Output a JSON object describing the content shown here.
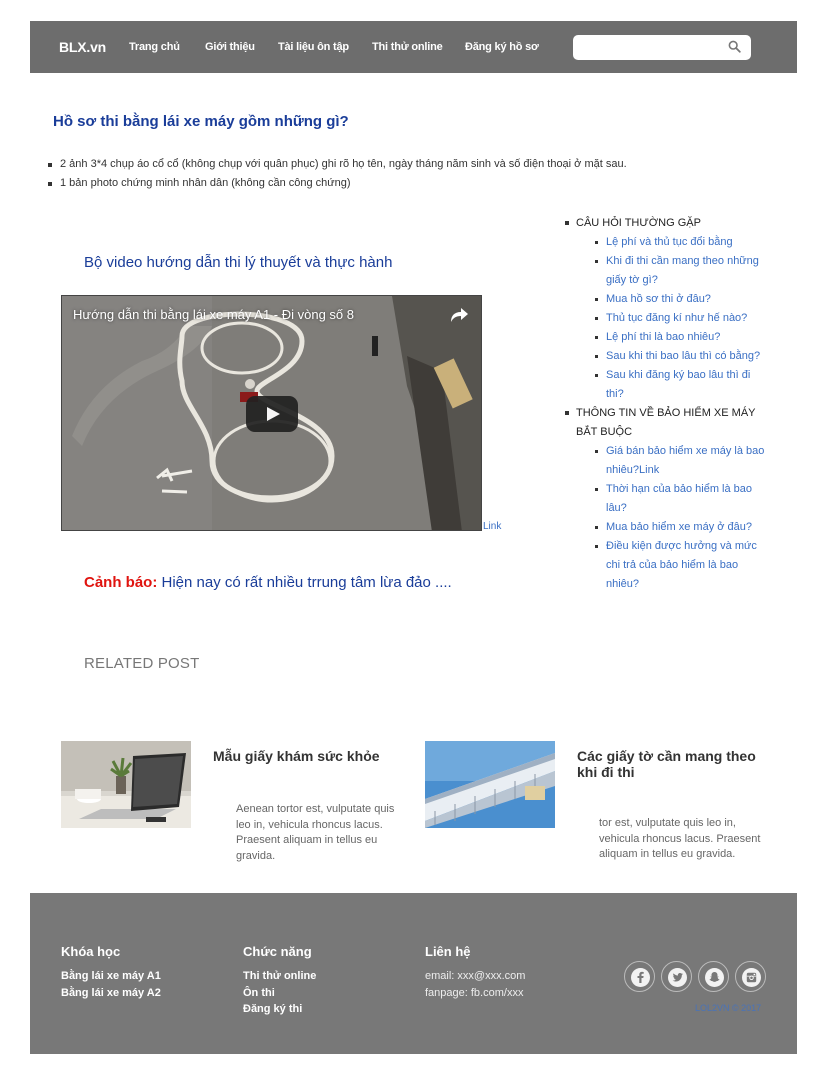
{
  "header": {
    "logo": "BLX.vn",
    "nav": [
      "Trang chủ",
      "Giới thiệu",
      "Tài liệu ôn tập",
      "Thi thử online",
      "Đăng ký hồ sơ"
    ],
    "search_placeholder": ""
  },
  "main": {
    "title": "Hồ sơ thi bằng lái xe máy gồm những gì?",
    "requirements": [
      "2 ảnh 3*4 chụp áo cổ cổ (không chụp với quân phục) ghi rõ họ tên, ngày tháng năm sinh và số điện thoại ở mặt sau.",
      "1 bản photo chứng minh nhân dân (không cần công chứng)"
    ],
    "video_heading": "Bộ video hướng dẫn thi lý thuyết và thực hành",
    "video_title": "Hướng dẫn thi bằng lái xe máy A1 - Đi vòng số 8",
    "video_link": "Link",
    "warning_label": "Cảnh báo:",
    "warning_text": " Hiện nay có rất nhiều trrung tâm lừa đảo ...."
  },
  "sidebar": {
    "sections": [
      {
        "heading": "CÂU HỎI THƯỜNG GẶP",
        "items": [
          "Lệ phí và thủ tục đổi bằng",
          "Khi đi thi cần mang theo những giấy tờ gì?",
          "Mua hồ sơ thi ở đâu?",
          "Thủ tục đăng kí như hế nào?",
          "Lệ phí thi là bao nhiêu?",
          "Sau khi thi bao lâu thì có bằng?",
          "Sau khi đăng ký bao lâu thì đi thi?"
        ]
      },
      {
        "heading": "THÔNG TIN VỀ BẢO HIỂM XE MÁY BẮT BUỘC",
        "items": [
          "Giá bán bảo hiểm xe máy là bao nhiêu?Link",
          "Thời hạn của bảo hiểm là bao lâu?",
          "Mua bảo hiểm xe máy ở đâu?",
          "Điều kiện được hưởng và mức chi trả của bảo hiểm là bao nhiêu?"
        ]
      }
    ]
  },
  "related": {
    "title": "RELATED POST",
    "posts": [
      {
        "title": "Mẫu giấy khám sức khỏe",
        "excerpt": "Aenean tortor est, vulputate quis leo in, vehicula rhoncus lacus. Praesent aliquam in tellus eu gravida."
      },
      {
        "title": "Các giấy tờ cần mang theo khi đi thi",
        "excerpt": "tor est, vulputate quis leo in, vehicula rhoncus lacus. Praesent aliquam in tellus eu gravida."
      }
    ]
  },
  "footer": {
    "col1": {
      "heading": "Khóa học",
      "lines": [
        "Bằng lái xe máy A1",
        "Bằng lái xe máy A2"
      ]
    },
    "col2": {
      "heading": "Chức năng",
      "lines": [
        "Thi thử online",
        "Ôn thi",
        "Đăng ký thi"
      ]
    },
    "col3": {
      "heading": "Liên hệ",
      "lines": [
        "email: xxx@xxx.com",
        "fanpage: fb.com/xxx"
      ]
    },
    "social": [
      "facebook-icon",
      "twitter-icon",
      "snapchat-icon",
      "instagram-icon"
    ],
    "copyright": "LOL2VN © 2017"
  },
  "colors": {
    "header_bg": "#6d6d6d",
    "footer_bg": "#787878",
    "title_blue": "#1a3d99",
    "link_blue": "#3a6fc4",
    "warning_red": "#e0140f"
  }
}
